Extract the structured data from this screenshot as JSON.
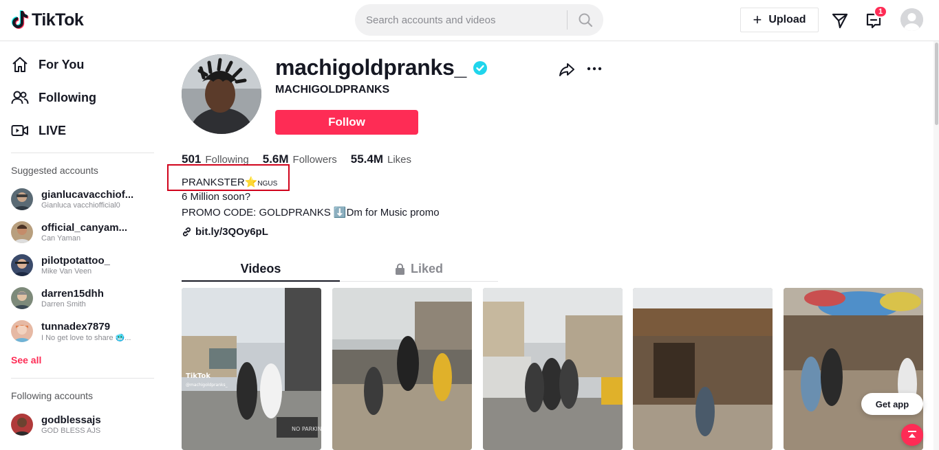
{
  "header": {
    "logo_text": "TikTok",
    "search_placeholder": "Search accounts and videos",
    "upload_label": "Upload",
    "inbox_badge": "1"
  },
  "sidebar": {
    "nav": [
      {
        "label": "For You",
        "icon": "home-icon"
      },
      {
        "label": "Following",
        "icon": "people-icon"
      },
      {
        "label": "LIVE",
        "icon": "live-icon"
      }
    ],
    "suggested_title": "Suggested accounts",
    "suggested": [
      {
        "username": "gianlucavacchiof...",
        "name": "Gianluca vacchiofficial0"
      },
      {
        "username": "official_canyam...",
        "name": "Can Yaman"
      },
      {
        "username": "pilotpotattoo_",
        "name": "Mike Van Veen"
      },
      {
        "username": "darren15dhh",
        "name": "Darren Smith"
      },
      {
        "username": "tunnadex7879",
        "name": "I No get love to share 🥶..."
      }
    ],
    "see_all": "See all",
    "following_title": "Following accounts",
    "following": [
      {
        "username": "godblessajs",
        "name": "GOD BLESS AJS"
      }
    ]
  },
  "profile": {
    "username": "machigoldpranks_",
    "nickname": "MACHIGOLDPRANKS",
    "follow_label": "Follow",
    "stats": [
      {
        "value": "501",
        "label": "Following"
      },
      {
        "value": "5.6M",
        "label": "Followers"
      },
      {
        "value": "55.4M",
        "label": "Likes"
      }
    ],
    "bio": {
      "line1_text": "PRANKSTER",
      "line1_star": "⭐",
      "line1_suffix": "NGUS",
      "line2": "6 Million soon?",
      "line3_prefix": "PROMO CODE: GOLDPRANKS ",
      "line3_arrow": "⬇️",
      "line3_suffix": "Dm for Music promo"
    },
    "link": "bit.ly/3QOy6pL"
  },
  "tabs": [
    {
      "label": "Videos",
      "active": true
    },
    {
      "label": "Liked",
      "active": false
    }
  ],
  "video_watermark": "TikTok",
  "video_handle": "@machigoldpranks_",
  "video_sign": "NO PARKING",
  "get_app_label": "Get app",
  "colors": {
    "accent": "#fe2c55",
    "verified": "#20d5ec",
    "highlight_box": "#d0021b"
  }
}
